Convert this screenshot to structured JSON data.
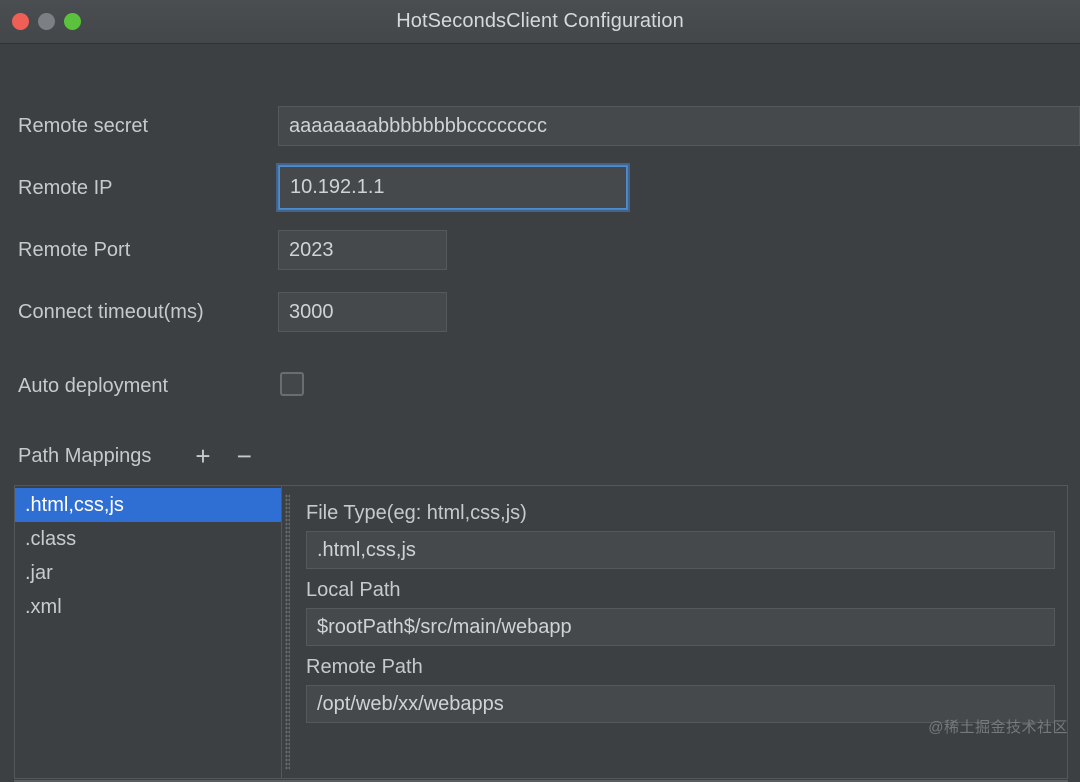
{
  "window": {
    "title": "HotSecondsClient Configuration",
    "traffic_lights": [
      {
        "name": "close",
        "color": "#ef5f56"
      },
      {
        "name": "minimize",
        "color": "#7c8084"
      },
      {
        "name": "maximize",
        "color": "#5bc23e"
      }
    ]
  },
  "form": {
    "remote_secret": {
      "label": "Remote secret",
      "value": "aaaaaaaabbbbbbbbcccccccc",
      "placeholder": "Remote secret"
    },
    "remote_ip": {
      "label": "Remote IP",
      "value": "10.192.1.1",
      "placeholder": "Remote IP",
      "focused": true
    },
    "remote_port": {
      "label": "Remote Port",
      "value": "2023",
      "placeholder": "Remote Port"
    },
    "connect_timeout": {
      "label": "Connect timeout(ms)",
      "value": "3000",
      "placeholder": "Connect timeout"
    },
    "auto_deployment": {
      "label": "Auto deployment",
      "checked": false
    }
  },
  "path_mappings": {
    "title": "Path Mappings",
    "add_label": "+",
    "remove_label": "−",
    "list": [
      {
        "label": ".html,css,js",
        "selected": true
      },
      {
        "label": ".class",
        "selected": false
      },
      {
        "label": ".jar",
        "selected": false
      },
      {
        "label": ".xml",
        "selected": false
      }
    ],
    "detail": {
      "file_type_label": "File Type(eg: html,css,js)",
      "file_type_value": ".html,css,js",
      "local_path_label": "Local Path",
      "local_path_value": "$rootPath$/src/main/webapp",
      "remote_path_label": "Remote Path",
      "remote_path_value": "/opt/web/xx/webapps"
    }
  },
  "watermark": "@稀土掘金技术社区",
  "colors": {
    "window_bg": "#3c4043",
    "titlebar_bg": "#45494c",
    "field_bg": "#46494c",
    "field_border": "#56595c",
    "text": "#c8cccd",
    "selection_blue": "#2f6fd4",
    "focus_border": "#4f8ccc"
  }
}
